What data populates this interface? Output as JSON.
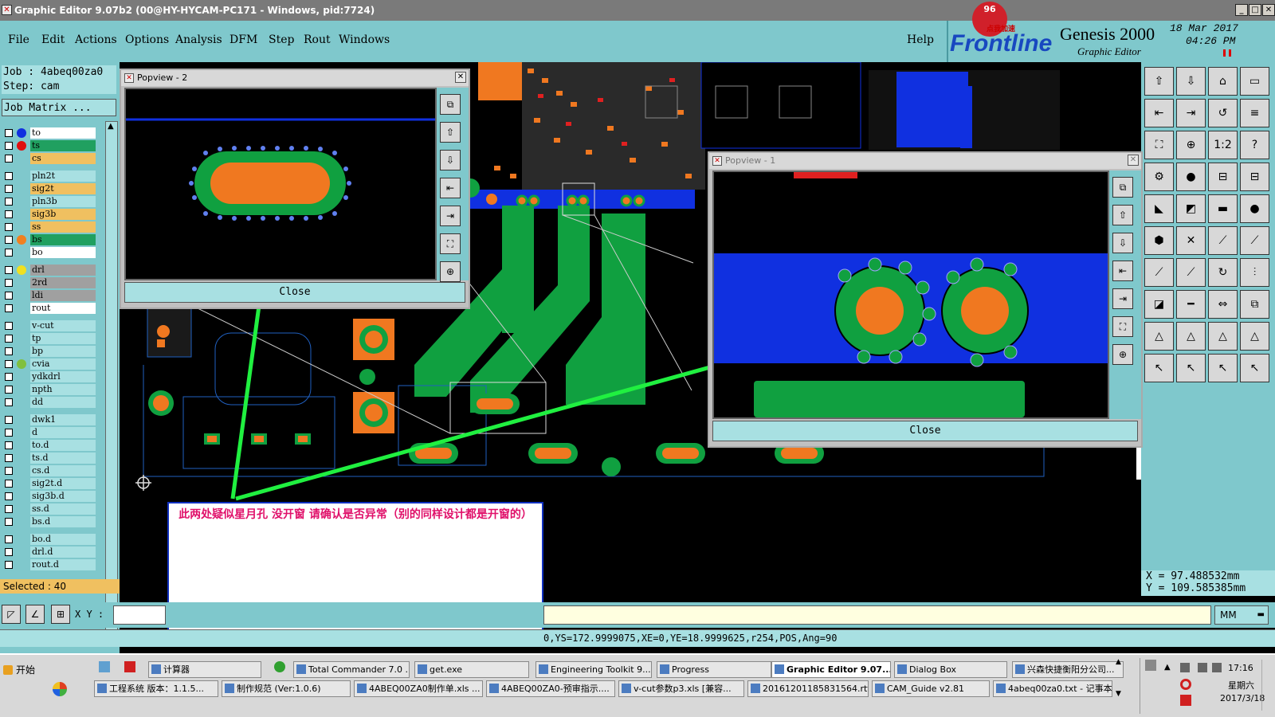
{
  "window": {
    "title": "Graphic Editor 9.07b2 (00@HY-HYCAM-PC171 - Windows, pid:7724)"
  },
  "menu": [
    "File",
    "Edit",
    "Actions",
    "Options",
    "Analysis",
    "DFM",
    "Step",
    "Rout",
    "Windows"
  ],
  "menu_help": "Help",
  "brand": {
    "badge": "96",
    "badge_note": "点我加速",
    "logo": "Frontline",
    "product": "Genesis 2000",
    "subtitle": "Graphic Editor",
    "date": "18 Mar 2017",
    "time": "04:26 PM"
  },
  "job": {
    "job_label": "Job : 4abeq00za0",
    "step_label": "Step: cam",
    "matrix_button": "Job Matrix ..."
  },
  "layers": [
    {
      "name": "to",
      "bg": "#ffffff",
      "dot": "#1030e0"
    },
    {
      "name": "ts",
      "bg": "#20a060",
      "dot": "#e01010"
    },
    {
      "name": "cs",
      "bg": "#f0c060",
      "dot": ""
    },
    {
      "name": "pln2t",
      "bg": "#a8e0e2",
      "dot": ""
    },
    {
      "name": "sig2t",
      "bg": "#f0c060",
      "dot": ""
    },
    {
      "name": "pln3b",
      "bg": "#a8e0e2",
      "dot": ""
    },
    {
      "name": "sig3b",
      "bg": "#f0c060",
      "dot": ""
    },
    {
      "name": "ss",
      "bg": "#f0c060",
      "dot": ""
    },
    {
      "name": "bs",
      "bg": "#20a060",
      "dot": "#f08020"
    },
    {
      "name": "bo",
      "bg": "#ffffff",
      "dot": ""
    },
    {
      "name": "drl",
      "bg": "#a0a0a0",
      "dot": "#f0e020"
    },
    {
      "name": "2rd",
      "bg": "#a0a0a0",
      "dot": ""
    },
    {
      "name": "ldi",
      "bg": "#a0a0a0",
      "dot": ""
    },
    {
      "name": "rout",
      "bg": "#ffffff",
      "dot": ""
    },
    {
      "name": "v-cut",
      "bg": "#a8e0e2",
      "dot": ""
    },
    {
      "name": "tp",
      "bg": "#a8e0e2",
      "dot": ""
    },
    {
      "name": "bp",
      "bg": "#a8e0e2",
      "dot": ""
    },
    {
      "name": "cvia",
      "bg": "#a8e0e2",
      "dot": "#80c040"
    },
    {
      "name": "ydkdrl",
      "bg": "#a8e0e2",
      "dot": ""
    },
    {
      "name": "npth",
      "bg": "#a8e0e2",
      "dot": ""
    },
    {
      "name": "dd",
      "bg": "#a8e0e2",
      "dot": ""
    },
    {
      "name": "dwk1",
      "bg": "#a8e0e2",
      "dot": ""
    },
    {
      "name": "d",
      "bg": "#a8e0e2",
      "dot": ""
    },
    {
      "name": "to.d",
      "bg": "#a8e0e2",
      "dot": ""
    },
    {
      "name": "ts.d",
      "bg": "#a8e0e2",
      "dot": ""
    },
    {
      "name": "cs.d",
      "bg": "#a8e0e2",
      "dot": ""
    },
    {
      "name": "sig2t.d",
      "bg": "#a8e0e2",
      "dot": ""
    },
    {
      "name": "sig3b.d",
      "bg": "#a8e0e2",
      "dot": ""
    },
    {
      "name": "ss.d",
      "bg": "#a8e0e2",
      "dot": ""
    },
    {
      "name": "bs.d",
      "bg": "#a8e0e2",
      "dot": ""
    },
    {
      "name": "bo.d",
      "bg": "#a8e0e2",
      "dot": ""
    },
    {
      "name": "drl.d",
      "bg": "#a8e0e2",
      "dot": ""
    },
    {
      "name": "rout.d",
      "bg": "#a8e0e2",
      "dot": ""
    }
  ],
  "selected": "Selected : 40",
  "popview2": {
    "title": "Popview - 2",
    "close": "Close"
  },
  "popview1": {
    "title": "Popview - 1",
    "close": "Close"
  },
  "annotation": "此两处疑似星月孔  没开窗   请确认是否异常（别的同样设计都是开窗的）",
  "coords": {
    "x": "X  =  97.488532mm",
    "y": "Y  =  109.585385mm"
  },
  "xy_label": "X Y :",
  "units": "MM",
  "status_line": "0,YS=172.9999075,XE=0,YE=18.9999625,r254,POS,Ang=90",
  "taskbar": {
    "start": "开始",
    "row1": [
      "计算器",
      "Total Commander 7.0 ...",
      "get.exe",
      "Engineering Toolkit 9....",
      "Progress",
      "Graphic Editor 9.07...",
      "Dialog Box",
      "兴森快捷衡阳分公司..."
    ],
    "row2": [
      "工程系统  版本：1.1.5...",
      "制作规范 (Ver:1.0.6)",
      "4ABEQ00ZA0制作单.xls ...",
      "4ABEQ00ZA0-预审指示....",
      "v-cut参数p3.xls [兼容...",
      "20161201185831564.rtf...",
      "CAM_Guide v2.81",
      "4abeq00za0.txt - 记事本"
    ],
    "time": "17:16",
    "weekday": "星期六",
    "date": "2017/3/18"
  },
  "colors": {
    "accent": "#7fc8cc",
    "pcb_green": "#10a040",
    "pad_orange": "#f07820",
    "copper_blue": "#1030e0",
    "annotation_red": "#e0106a"
  }
}
